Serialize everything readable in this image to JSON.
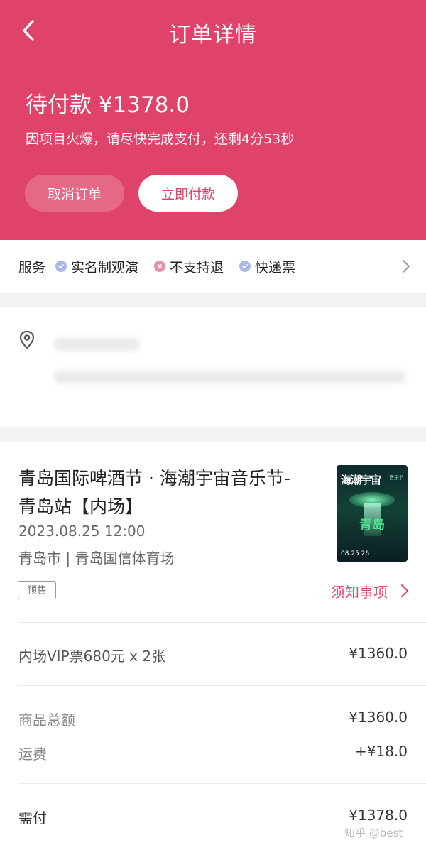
{
  "header": {
    "nav_title": "订单详情",
    "status_title": "待付款 ¥1378.0",
    "status_subtitle": "因项目火爆，请尽快完成支付，还剩4分53秒",
    "cancel_label": "取消订单",
    "pay_label": "立即付款",
    "accent_color": "#e0436a"
  },
  "services": {
    "label": "服务",
    "items": [
      {
        "text": "实名制观演",
        "icon": "check-circle-icon"
      },
      {
        "text": "不支持退",
        "icon": "cross-circle-icon"
      },
      {
        "text": "快递票",
        "icon": "check-circle-icon"
      }
    ]
  },
  "event": {
    "title": "青岛国际啤酒节 · 海潮宇宙音乐节-青岛站【内场】",
    "datetime": "2023.08.25 12:00",
    "venue": "青岛市 | 青岛国信体育场",
    "tag": "预售",
    "notice_label": "须知事项",
    "poster": {
      "title": "海潮宇宙",
      "subtitle": "音乐节",
      "city": "青岛",
      "date": "08.25 26"
    }
  },
  "order": {
    "ticket_line": "内场VIP票680元 x 2张",
    "ticket_amount": "¥1360.0",
    "subtotal_label": "商品总额",
    "subtotal_value": "¥1360.0",
    "shipping_label": "运费",
    "shipping_value": "+¥18.0",
    "total_label": "需付",
    "total_value": "¥1378.0"
  },
  "watermark": "知乎 @best"
}
